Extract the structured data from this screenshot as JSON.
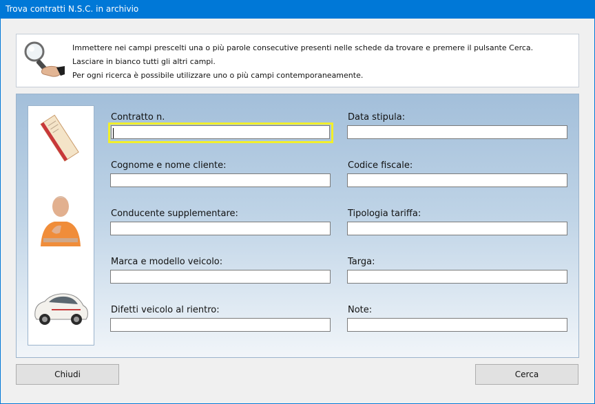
{
  "window": {
    "title": "Trova contratti N.S.C. in archivio"
  },
  "info": {
    "lines": [
      "Immettere nei campi prescelti una o più parole consecutive presenti nelle schede da trovare e premere il pulsante Cerca.",
      "Lasciare in bianco tutti gli altri campi.",
      "Per ogni ricerca è possibile utilizzare uno o più campi contemporaneamente."
    ]
  },
  "fields": {
    "contratto": {
      "label": "Contratto n.",
      "value": ""
    },
    "data_stipula": {
      "label": "Data stipula:",
      "value": ""
    },
    "cognome": {
      "label": "Cognome e nome cliente:",
      "value": ""
    },
    "codice_fiscale": {
      "label": "Codice fiscale:",
      "value": ""
    },
    "conducente": {
      "label": "Conducente supplementare:",
      "value": ""
    },
    "tipologia": {
      "label": "Tipologia tariffa:",
      "value": ""
    },
    "marca": {
      "label": "Marca e modello veicolo:",
      "value": ""
    },
    "targa": {
      "label": "Targa:",
      "value": ""
    },
    "difetti": {
      "label": "Difetti veicolo al rientro:",
      "value": ""
    },
    "note": {
      "label": "Note:",
      "value": ""
    }
  },
  "buttons": {
    "close_label": "Chiudi",
    "search_label": "Cerca"
  },
  "icons": {
    "magnifier": "magnifier-icon",
    "document": "document-icon",
    "person": "person-photo",
    "car": "car-photo"
  }
}
